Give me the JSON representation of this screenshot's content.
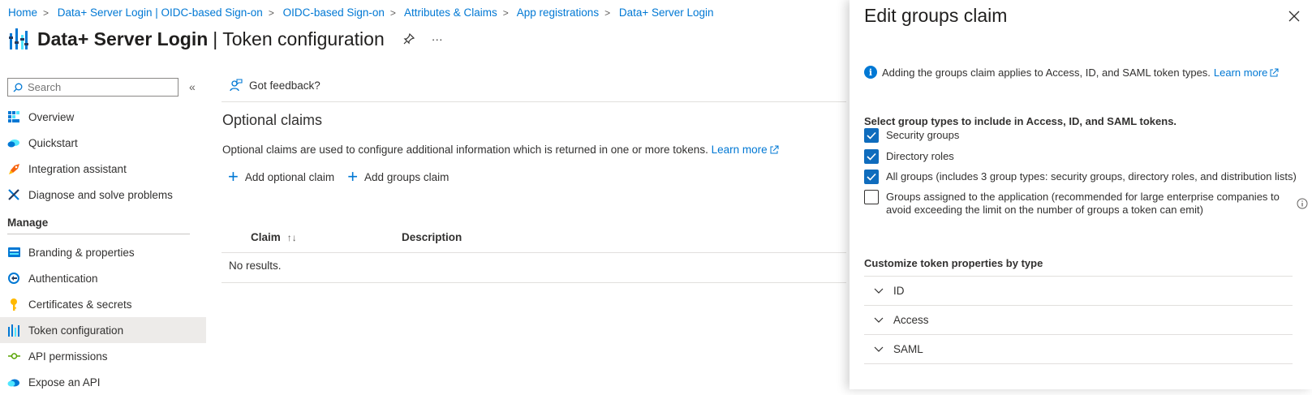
{
  "breadcrumb": [
    "Home",
    "Data+ Server Login | OIDC-based Sign-on",
    "OIDC-based Sign-on",
    "Attributes & Claims",
    "App registrations",
    "Data+ Server Login"
  ],
  "header": {
    "app_name": "Data+ Server Login",
    "separator": "|",
    "page_name": "Token configuration",
    "more": "···"
  },
  "sidebar": {
    "search_placeholder": "Search",
    "collapse": "«",
    "items": [
      {
        "label": "Overview",
        "icon": "overview-icon"
      },
      {
        "label": "Quickstart",
        "icon": "quickstart-icon"
      },
      {
        "label": "Integration assistant",
        "icon": "rocket-icon"
      },
      {
        "label": "Diagnose and solve problems",
        "icon": "wrench-icon"
      }
    ],
    "group_label": "Manage",
    "manage_items": [
      {
        "label": "Branding & properties",
        "icon": "branding-icon"
      },
      {
        "label": "Authentication",
        "icon": "authentication-icon"
      },
      {
        "label": "Certificates & secrets",
        "icon": "key-icon"
      },
      {
        "label": "Token configuration",
        "icon": "token-icon",
        "selected": true
      },
      {
        "label": "API permissions",
        "icon": "api-icon"
      },
      {
        "label": "Expose an API",
        "icon": "cloud-icon"
      }
    ]
  },
  "main": {
    "feedback": "Got feedback?",
    "section_title": "Optional claims",
    "description": "Optional claims are used to configure additional information which is returned in one or more tokens.",
    "learn_more": "Learn more",
    "add_optional_claim": "Add optional claim",
    "add_groups_claim": "Add groups claim",
    "table": {
      "columns": [
        "Claim",
        "Description"
      ],
      "sort_indicator": "↑↓",
      "empty": "No results."
    }
  },
  "panel": {
    "title": "Edit groups claim",
    "info": "Adding the groups claim applies to Access, ID, and SAML token types.",
    "info_link": "Learn more",
    "select_label": "Select group types to include in Access, ID, and SAML tokens.",
    "options": [
      {
        "label": "Security groups",
        "checked": true
      },
      {
        "label": "Directory roles",
        "checked": true
      },
      {
        "label": "All groups (includes 3 group types: security groups, directory roles, and distribution lists)",
        "checked": true
      },
      {
        "label_line1": "Groups assigned to the application (recommended for large enterprise companies to",
        "label_line2": "avoid exceeding the limit on the number of groups a token can emit)",
        "checked": false
      }
    ],
    "customize_label": "Customize token properties by type",
    "accordions": [
      "ID",
      "Access",
      "SAML"
    ]
  },
  "colors": {
    "accent": "#0078d4",
    "checkbox": "#0f6cbd",
    "selected_nav": "#edebe9"
  }
}
